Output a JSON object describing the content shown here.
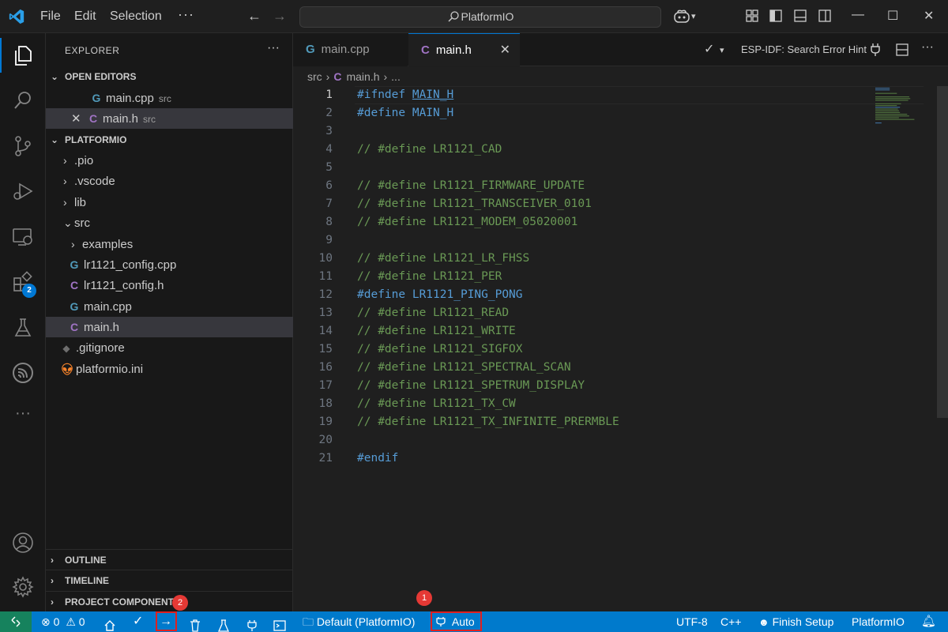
{
  "titlebar": {
    "menu": [
      "File",
      "Edit",
      "Selection"
    ],
    "more": "···",
    "search": "PlatformIO",
    "win_min": "—",
    "win_max": "☐",
    "win_close": "✕"
  },
  "activity": {
    "extensions_badge": "2",
    "more": "···"
  },
  "sidebar": {
    "title": "EXPLORER",
    "more": "···",
    "open_editors_header": "OPEN EDITORS",
    "open_editors": [
      {
        "name": "main.cpp",
        "desc": "src",
        "type": "cpp"
      },
      {
        "name": "main.h",
        "desc": "src",
        "type": "h"
      }
    ],
    "project_header": "PLATFORMIO",
    "tree": [
      {
        "name": ".pio",
        "kind": "folder"
      },
      {
        "name": ".vscode",
        "kind": "folder"
      },
      {
        "name": "lib",
        "kind": "folder"
      },
      {
        "name": "src",
        "kind": "folder-open"
      },
      {
        "name": "examples",
        "kind": "folder"
      },
      {
        "name": "lr1121_config.cpp",
        "kind": "cpp"
      },
      {
        "name": "lr1121_config.h",
        "kind": "h"
      },
      {
        "name": "main.cpp",
        "kind": "cpp"
      },
      {
        "name": "main.h",
        "kind": "h"
      },
      {
        "name": ".gitignore",
        "kind": "git"
      },
      {
        "name": "platformio.ini",
        "kind": "pio"
      }
    ],
    "outline": "OUTLINE",
    "timeline": "TIMELINE",
    "project_components": "PROJECT COMPONENTS"
  },
  "tabs": [
    {
      "label": "main.cpp",
      "type": "cpp",
      "active": false
    },
    {
      "label": "main.h",
      "type": "h",
      "active": true
    }
  ],
  "editor_actions": {
    "hint": "ESP-IDF: Search Error Hint"
  },
  "breadcrumb": {
    "folder": "src",
    "file": "main.h",
    "tail": "..."
  },
  "code": [
    {
      "n": "1",
      "text": "#ifndef MAIN_H"
    },
    {
      "n": "2",
      "text": "#define MAIN_H"
    },
    {
      "n": "3",
      "text": ""
    },
    {
      "n": "4",
      "text": "// #define LR1121_CAD"
    },
    {
      "n": "5",
      "text": ""
    },
    {
      "n": "6",
      "text": "// #define LR1121_FIRMWARE_UPDATE"
    },
    {
      "n": "7",
      "text": "// #define LR1121_TRANSCEIVER_0101"
    },
    {
      "n": "8",
      "text": "// #define LR1121_MODEM_05020001"
    },
    {
      "n": "9",
      "text": ""
    },
    {
      "n": "10",
      "text": "// #define LR1121_LR_FHSS"
    },
    {
      "n": "11",
      "text": "// #define LR1121_PER"
    },
    {
      "n": "12",
      "text": "#define LR1121_PING_PONG"
    },
    {
      "n": "13",
      "text": "// #define LR1121_READ"
    },
    {
      "n": "14",
      "text": "// #define LR1121_WRITE"
    },
    {
      "n": "15",
      "text": "// #define LR1121_SIGFOX"
    },
    {
      "n": "16",
      "text": "// #define LR1121_SPECTRAL_SCAN"
    },
    {
      "n": "17",
      "text": "// #define LR1121_SPETRUM_DISPLAY"
    },
    {
      "n": "18",
      "text": "// #define LR1121_TX_CW"
    },
    {
      "n": "19",
      "text": "// #define LR1121_TX_INFINITE_PRERMBLE"
    },
    {
      "n": "20",
      "text": ""
    },
    {
      "n": "21",
      "text": "#endif"
    }
  ],
  "status": {
    "errors": "0",
    "warnings": "0",
    "env": "Default (PlatformIO)",
    "port": "Auto",
    "encoding": "UTF-8",
    "language": "C++",
    "finish_setup": "Finish Setup",
    "platformio": "PlatformIO",
    "marker1": "1",
    "marker2": "2"
  },
  "colors": {
    "accent": "#0078d4",
    "statusbar": "#007acc",
    "remote": "#16825d",
    "highlight": "#e02020"
  }
}
